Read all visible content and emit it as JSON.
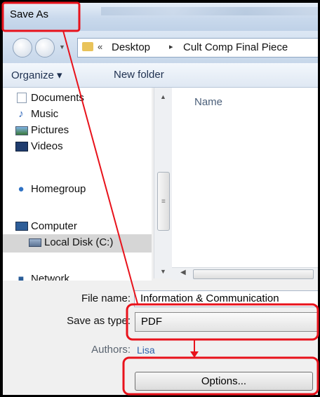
{
  "window": {
    "title": "Save As"
  },
  "address_bar": {
    "root_chevron": "«",
    "crumbs": [
      "Desktop",
      "Cult Comp Final Piece"
    ],
    "separator": "▸"
  },
  "toolbar": {
    "organize_label": "Organize ▾",
    "new_folder_label": "New folder"
  },
  "nav_pane": {
    "libraries": [
      {
        "label": "Documents",
        "icon": "documents-icon"
      },
      {
        "label": "Music",
        "icon": "music-icon"
      },
      {
        "label": "Pictures",
        "icon": "pictures-icon"
      },
      {
        "label": "Videos",
        "icon": "videos-icon"
      }
    ],
    "homegroup": {
      "label": "Homegroup",
      "icon": "homegroup-icon"
    },
    "computer": {
      "label": "Computer",
      "icon": "computer-icon"
    },
    "local_disk": {
      "label": "Local Disk (C:)",
      "icon": "drive-icon"
    },
    "network": {
      "label": "Network",
      "icon": "network-icon"
    }
  },
  "file_pane": {
    "column_name": "Name"
  },
  "form": {
    "file_name_label": "File name:",
    "file_name_value": "Information & Communication",
    "save_type_label": "Save as type:",
    "save_type_value": "PDF",
    "authors_label": "Authors:",
    "authors_value": "Lisa",
    "options_label": "Options..."
  },
  "annotation": {
    "color": "#e8121b"
  }
}
